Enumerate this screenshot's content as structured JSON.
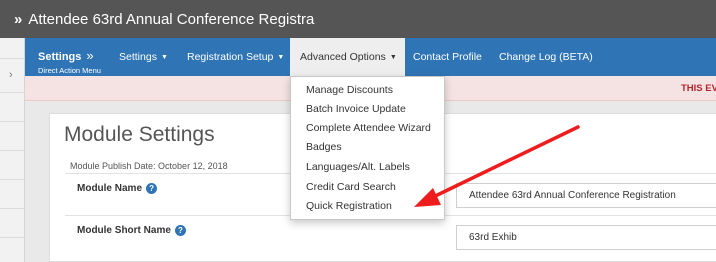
{
  "titlebar": {
    "chevron": "»",
    "title": "Attendee 63rd Annual Conference Registra"
  },
  "leftrail": {
    "arrow": "›"
  },
  "navbar": {
    "brand_title": "Settings",
    "brand_chevron": "»",
    "brand_subtitle": "Direct Action Menu",
    "items": [
      {
        "label": "Settings",
        "caret": "▼"
      },
      {
        "label": "Registration Setup",
        "caret": "▼"
      },
      {
        "label": "Advanced Options",
        "caret": "▼"
      },
      {
        "label": "Contact Profile"
      },
      {
        "label": "Change Log (BETA)"
      }
    ]
  },
  "alert": {
    "text": "THIS EV"
  },
  "dropdown": {
    "items": [
      "Manage Discounts",
      "Batch Invoice Update",
      "Complete Attendee Wizard",
      "Badges",
      "Languages/Alt. Labels",
      "Credit Card Search",
      "Quick Registration"
    ]
  },
  "panel": {
    "title": "Module Settings",
    "publish_date": "Module Publish Date: October 12, 2018",
    "help_glyph": "?",
    "fields": [
      {
        "label": "Module Name",
        "value": "Attendee 63rd Annual Conference Registration"
      },
      {
        "label": "Module Short Name",
        "value": "63rd Exhib"
      }
    ]
  },
  "colors": {
    "titlebar": "#555555",
    "navbar": "#2f74b5",
    "alert_band": "#f5e3e3",
    "alert_text": "#b4252d",
    "annotation_arrow": "#ee1c1c"
  },
  "icons": [
    "chevron-right-icon",
    "caret-down-icon",
    "help-icon",
    "red-arrow-annotation"
  ]
}
